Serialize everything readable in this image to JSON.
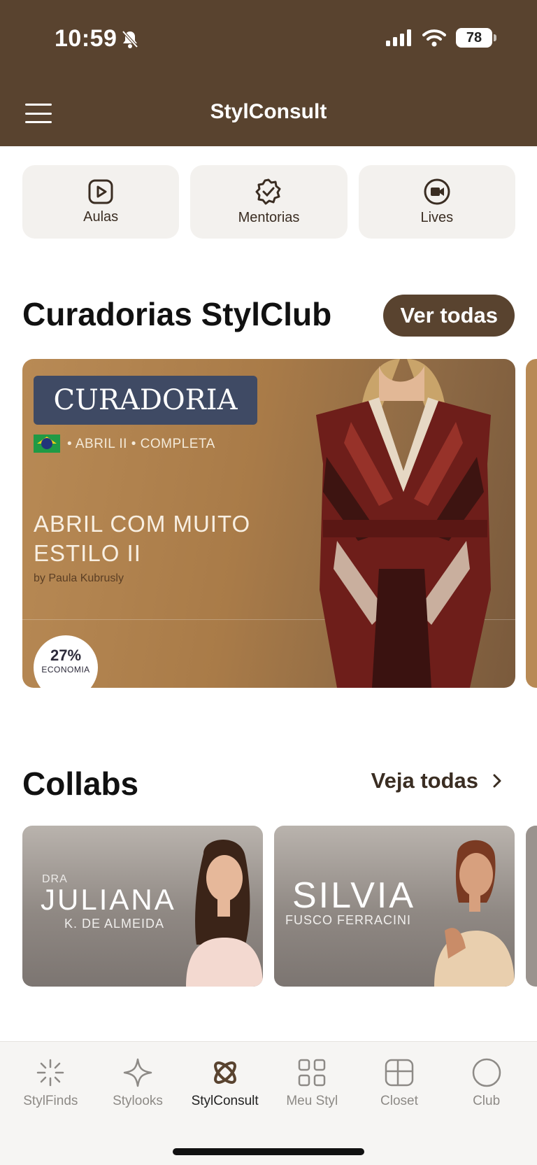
{
  "status_bar": {
    "time": "10:59",
    "battery": "78"
  },
  "header": {
    "title": "StylConsult"
  },
  "quick_actions": [
    {
      "label": "Aulas",
      "icon": "play-square-icon"
    },
    {
      "label": "Mentorias",
      "icon": "badge-check-icon"
    },
    {
      "label": "Lives",
      "icon": "video-camera-icon"
    }
  ],
  "curadorias": {
    "title": "Curadorias StylClub",
    "button_label": "Ver todas",
    "banner": {
      "badge": "CURADORIA",
      "edition": "• ABRIL II • COMPLETA",
      "headline": "ABRIL COM MUITO ESTILO II",
      "author": "by Paula Kubrusly",
      "discount_value": "27%",
      "discount_label": "ECONOMIA"
    }
  },
  "collabs": {
    "title": "Collabs",
    "link_label": "Veja todas",
    "items": [
      {
        "prefix": "DRA",
        "name": "JULIANA",
        "subtitle": "K. DE ALMEIDA"
      },
      {
        "prefix": "",
        "name": "SILVIA",
        "subtitle": "FUSCO FERRACINI"
      }
    ]
  },
  "tabbar": {
    "items": [
      {
        "label": "StylFinds",
        "icon": "sparkle-burst-icon"
      },
      {
        "label": "Stylooks",
        "icon": "star-icon"
      },
      {
        "label": "StylConsult",
        "icon": "atom-icon",
        "active": true
      },
      {
        "label": "Meu Styl",
        "icon": "grid-icon"
      },
      {
        "label": "Closet",
        "icon": "closet-icon"
      },
      {
        "label": "Club",
        "icon": "circle-icon"
      }
    ]
  },
  "colors": {
    "brand": "#59432f",
    "card_bg": "#f3f1ee",
    "banner": "#b88a55"
  }
}
